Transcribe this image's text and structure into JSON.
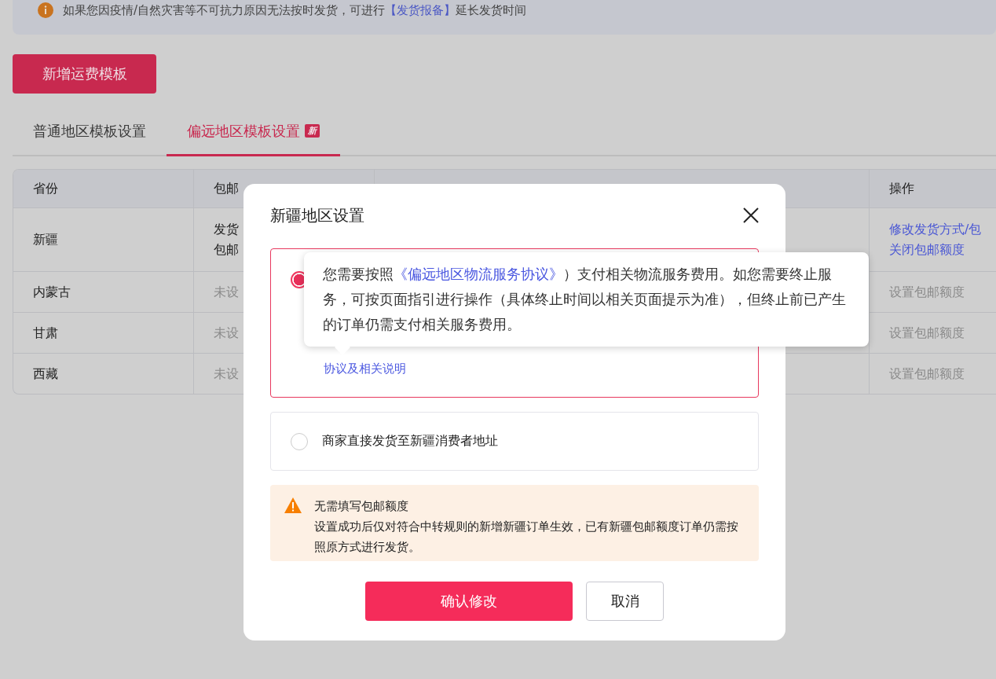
{
  "notice": {
    "text_before": "如果您因疫情/自然灾害等不可抗力原因无法按时发货，可进行",
    "link": "【发货报备】",
    "text_after": "延长发货时间"
  },
  "create_button": "新增运费模板",
  "tabs": [
    {
      "label": "普通地区模板设置",
      "selected": false
    },
    {
      "label": "偏远地区模板设置",
      "selected": true,
      "badge": "新"
    }
  ],
  "table": {
    "columns": [
      "省份",
      "包邮",
      "操作"
    ],
    "rows": [
      {
        "province": "新疆",
        "column_2": [
          "发货",
          "包邮"
        ],
        "actions": [
          [
            {
              "label": "修改发货方式/包",
              "kind": "link"
            }
          ],
          [
            {
              "label": "关闭包邮额度",
              "kind": "link"
            }
          ]
        ]
      },
      {
        "province": "内蒙古",
        "column_2": [
          "未设"
        ],
        "actions": [
          [
            {
              "label": "设置包邮额度",
              "kind": "muted"
            }
          ]
        ]
      },
      {
        "province": "甘肃",
        "column_2": [
          "未设"
        ],
        "actions": [
          [
            {
              "label": "设置包邮额度",
              "kind": "muted"
            }
          ]
        ]
      },
      {
        "province": "西藏",
        "column_2": [
          "未设"
        ],
        "actions": [
          [
            {
              "label": "设置包邮额度",
              "kind": "muted"
            }
          ]
        ]
      }
    ]
  },
  "modal": {
    "title": "新疆地区设置",
    "options": [
      {
        "selected": true,
        "link": "协议及相关说明"
      },
      {
        "selected": false,
        "label": "商家直接发货至新疆消费者地址"
      }
    ],
    "warning": {
      "title": "无需填写包邮额度",
      "body": "设置成功后仅对符合中转规则的新增新疆订单生效，已有新疆包邮额度订单仍需按照原方式进行发货。"
    },
    "buttons": [
      {
        "label": "确认修改",
        "kind": "primary"
      },
      {
        "label": "取消",
        "kind": "secondary"
      }
    ]
  },
  "tooltip": {
    "text_before": "您需要按照",
    "link": "《偏远地区物流服务协议》",
    "text_after": "）支付相关物流服务费用。如您需要终止服务，可按页面指引进行操作（具体终止时间以相关页面提示为准），但终止前已产生的订单仍需支付相关服务费用。"
  }
}
